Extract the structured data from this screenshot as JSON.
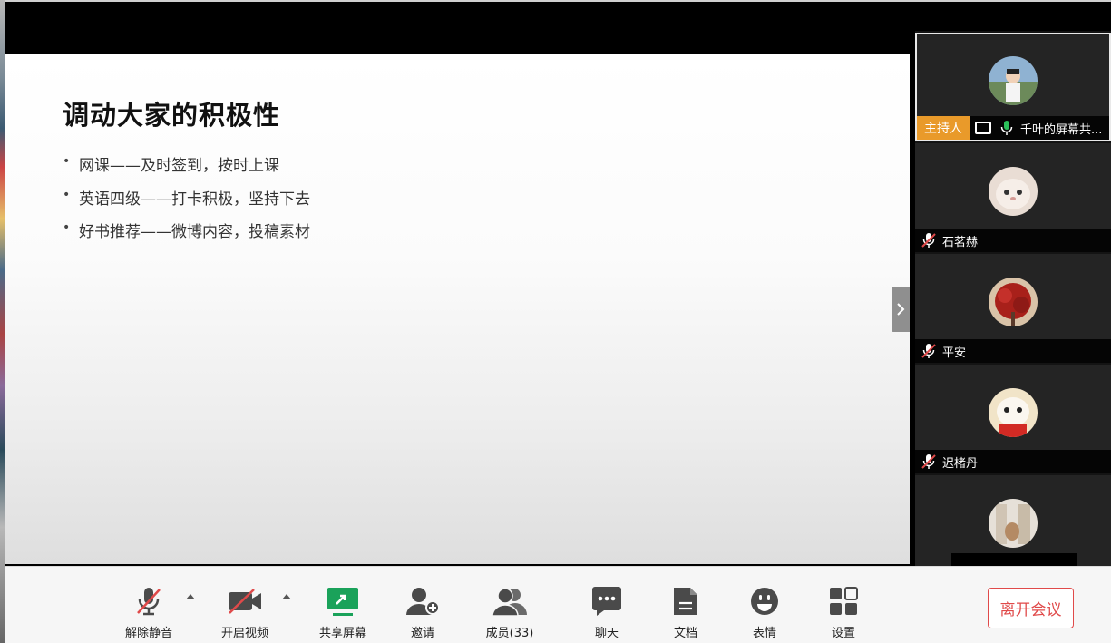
{
  "slide": {
    "title": "调动大家的积极性",
    "bullets": [
      "网课——及时签到，按时上课",
      "英语四级——打卡积极，坚持下去",
      "好书推荐——微博内容，投稿素材"
    ]
  },
  "participants": {
    "host_badge": "主持人",
    "items": [
      {
        "name": "千叶的屏幕共...",
        "mic": "on",
        "sharing": true,
        "host": true
      },
      {
        "name": "石茗赫",
        "mic": "muted"
      },
      {
        "name": "平安",
        "mic": "muted"
      },
      {
        "name": "迟楮丹",
        "mic": "muted"
      },
      {
        "name": "",
        "mic": ""
      }
    ]
  },
  "toolbar": {
    "unmute_label": "解除静音",
    "video_label": "开启视频",
    "share_label": "共享屏幕",
    "invite_label": "邀请",
    "members_label": "成员(33)",
    "chat_label": "聊天",
    "docs_label": "文档",
    "emoji_label": "表情",
    "settings_label": "设置",
    "leave_label": "离开会议"
  },
  "colors": {
    "accent_green": "#1aa25a",
    "danger_red": "#e04a4a",
    "host_orange": "#e99a2a"
  }
}
